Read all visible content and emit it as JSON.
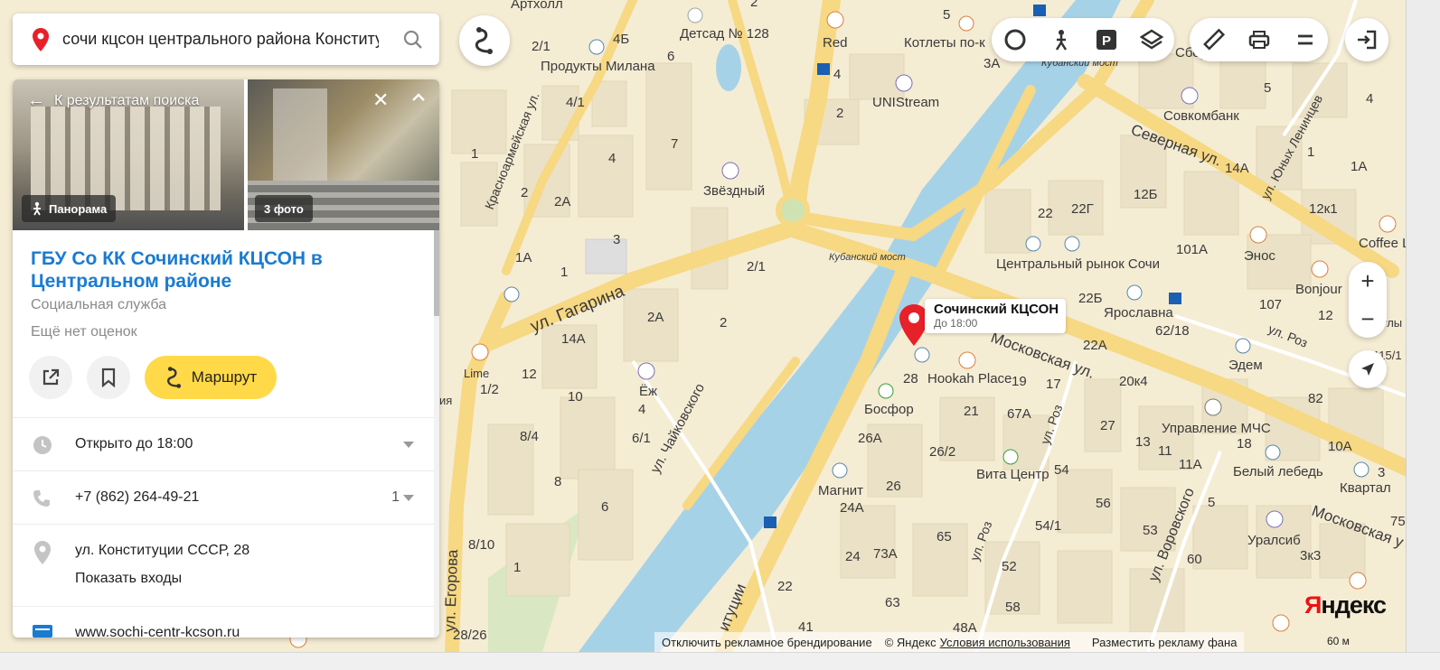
{
  "search": {
    "query": "сочи кцсон центрального района Конститу"
  },
  "panel": {
    "back_label": "К результатам поиска",
    "panorama_label": "Панорама",
    "photos_label": "3 фото",
    "title": "ГБУ Со КК Сочинский КЦСОН в Центральном районе",
    "category": "Социальная служба",
    "rating": "Ещё нет оценок",
    "route_label": "Маршрут",
    "hours": "Открыто до 18:00",
    "phone": "+7 (862) 264-49-21",
    "phone_count": "1",
    "address": "ул. Конституции СССР, 28",
    "entrances_link": "Показать входы",
    "website": "www.sochi-centr-kcson.ru"
  },
  "marker": {
    "name": "Сочинский КЦСОН",
    "hours": "До 18:00"
  },
  "map_labels": {
    "l1": "Артхолл",
    "l2": "Детсад № 128",
    "l3": "4Б",
    "l4": "2/1",
    "l5": "6",
    "l6": "Продукты Милана",
    "l7": "Котлеты по-к",
    "l8": "Red",
    "l9": "UNIStream",
    "l10": "4/1",
    "l11": "7",
    "l12": "2",
    "l13": "Звёздный",
    "l14": "4",
    "l15": "1",
    "l16": "2",
    "l17": "2А",
    "l18": "3",
    "l19": "1А",
    "l20": "1",
    "l21": "2/1",
    "l22": "2А",
    "l23": "2",
    "l24": "14А",
    "l25": "Ёж",
    "l26": "4",
    "l27": "12",
    "l28": "10",
    "l29": "1/2",
    "l30": "8/4",
    "l31": "6/1",
    "l32": "8",
    "l33": "6",
    "l34": "8/10",
    "l35": "1",
    "l36": "28/26",
    "l37": "Lime",
    "l38": "ия",
    "l39": "Кубанский мост",
    "l40": "Кубанский мост",
    "l41": "Совкомбанк",
    "l42": "Северная ул.",
    "l43": "12Б",
    "l44": "22",
    "l45": "22Г",
    "l46": "12к1",
    "l47": "Центральный рынок Сочи",
    "l48": "101А",
    "l49": "Энос",
    "l50": "Coffee Li",
    "l51": "Bonjour",
    "l52": "22Б",
    "l53": "107",
    "l54": "12",
    "l55": "Ярославна",
    "l56": "62/18",
    "l57": "22А",
    "l58": "Эдем",
    "l59": "Московская ул.",
    "l60": "20к4",
    "l61": "82",
    "l62": "Hookah Place",
    "l63": "28",
    "l64": "19",
    "l65": "17",
    "l66": "Босфор",
    "l67": "21",
    "l68": "67А",
    "l69": "27",
    "l70": "13",
    "l71": "11",
    "l72": "Управление МЧС",
    "l73": "18",
    "l74": "10А",
    "l75": "26А",
    "l76": "26/2",
    "l77": "Вита Центр",
    "l78": "54",
    "l79": "11А",
    "l80": "Белый лебедь",
    "l81": "3",
    "l82": "Квартал",
    "l83": "Магнит",
    "l84": "26",
    "l85": "24А",
    "l86": "56",
    "l87": "53",
    "l88": "5",
    "l89": "54/1",
    "l90": "65",
    "l91": "75",
    "l92": "Уралсиб",
    "l93": "Московская у",
    "l94": "24",
    "l95": "73А",
    "l96": "52",
    "l97": "60",
    "l98": "3к3",
    "l99": "22",
    "l100": "63",
    "l101": "58",
    "l102": "48А",
    "l103": "41",
    "l104": "ул. Гагарина",
    "l105": "Красноармейская ул.",
    "l106": "ул. Чайковского",
    "l107": "ул. Егорова",
    "l108": "ул. Роз",
    "l109": "ул. Роз",
    "l110": "ул. Воровского",
    "l111": "ул. Юных Ленинцев",
    "l112": "итуции",
    "l113": "ул. Роз",
    "l114": "1А",
    "l115": "1",
    "l116": "4",
    "l117": "14А",
    "l118": "5",
    "l119": "Сбер",
    "l120": "3А",
    "l121": "5",
    "l122": "2",
    "l123": "4",
    "l124": "улы",
    "l125": "115/1"
  },
  "footer": {
    "ads_off": "Отключить рекламное брендирование",
    "copyright": "© Яндекс",
    "terms": "Условия использования",
    "place_ad": "Разместить рекламу",
    "fa": "фанa",
    "scale": "60 м"
  },
  "logo": {
    "first": "Я",
    "rest": "ндекс"
  },
  "colors": {
    "accent_link": "#1a7bd1",
    "route_button": "#ffd948",
    "marker": "#e8202a",
    "water": "#a6d2e8",
    "road": "#f7d883",
    "land": "#f5ecd4",
    "block": "#ebe1c6"
  }
}
